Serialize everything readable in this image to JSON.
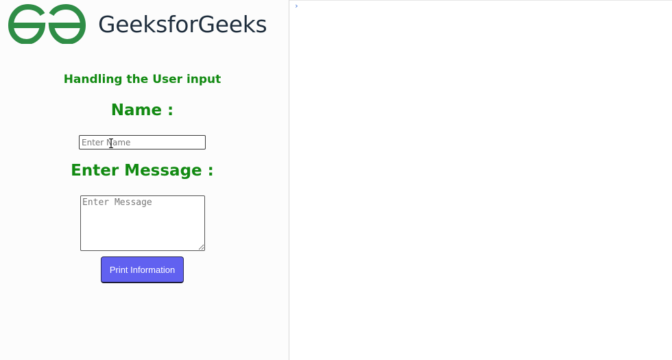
{
  "logo": {
    "icon": "gfg-logo-icon",
    "text": "GeeksforGeeks",
    "mark_color": "#2f8d46",
    "text_color": "#1f2e3d"
  },
  "form": {
    "title": "Handling the User input",
    "name_label": "Name :",
    "name_placeholder": "Enter Name",
    "message_label": "Enter Message :",
    "message_placeholder": "Enter Message",
    "button_label": "Print Information",
    "accent_color": "#128a12",
    "button_color": "#6161f0"
  },
  "console": {
    "prompt_icon": "chevron-right-icon",
    "prompt_glyph": "›",
    "prompt_color": "#3b6fd4"
  }
}
